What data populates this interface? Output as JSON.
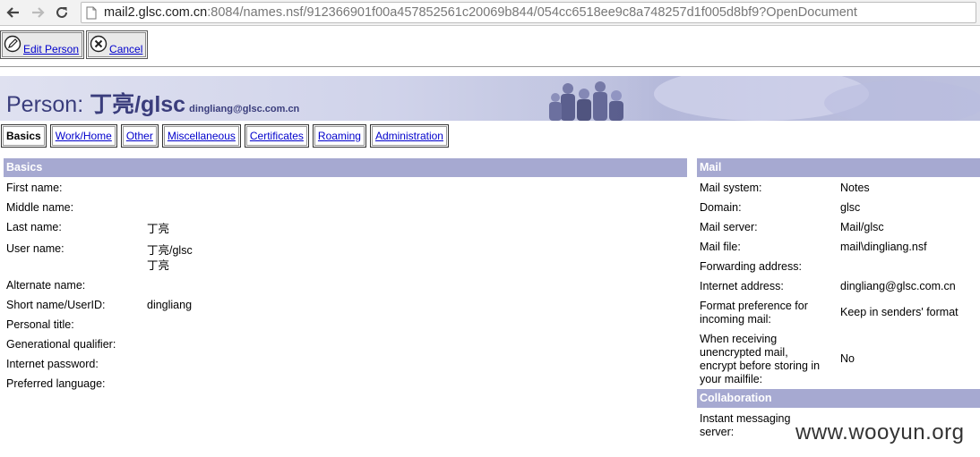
{
  "browser": {
    "url_host": "mail2.glsc.com.cn",
    "url_rest": ":8084/names.nsf/912366901f00a457852561c20069b844/054cc6518ee9c8a748257d1f005d8bf9?OpenDocument"
  },
  "actions": {
    "edit_label": "Edit Person",
    "cancel_label": "Cancel"
  },
  "banner": {
    "prefix": "Person: ",
    "name": "丁亮/glsc",
    "email": "dingliang@glsc.com.cn"
  },
  "tabs": [
    {
      "label": "Basics",
      "active": true
    },
    {
      "label": "Work/Home"
    },
    {
      "label": "Other"
    },
    {
      "label": "Miscellaneous"
    },
    {
      "label": "Certificates"
    },
    {
      "label": "Roaming"
    },
    {
      "label": "Administration"
    }
  ],
  "basics": {
    "header": "Basics",
    "fields": [
      {
        "label": "First name:",
        "value": ""
      },
      {
        "label": "Middle name:",
        "value": ""
      },
      {
        "label": "Last name:",
        "value": "丁亮"
      },
      {
        "label": "User name:",
        "value": "丁亮/glsc",
        "value2": "丁亮"
      },
      {
        "label": "Alternate name:",
        "value": ""
      },
      {
        "label": "Short name/UserID:",
        "value": "dingliang"
      },
      {
        "label": "Personal title:",
        "value": ""
      },
      {
        "label": "Generational qualifier:",
        "value": ""
      },
      {
        "label": "Internet password:",
        "value": ""
      },
      {
        "label": "Preferred language:",
        "value": ""
      }
    ]
  },
  "mail": {
    "header": "Mail",
    "fields": [
      {
        "label": "Mail system:",
        "value": "Notes"
      },
      {
        "label": "Domain:",
        "value": "glsc"
      },
      {
        "label": "Mail server:",
        "value": "Mail/glsc"
      },
      {
        "label": "Mail file:",
        "value": "mail\\dingliang.nsf"
      },
      {
        "label": "Forwarding address:",
        "value": ""
      },
      {
        "label": "Internet address:",
        "value": "dingliang@glsc.com.cn"
      },
      {
        "label": "Format preference for",
        "label2": "incoming mail:",
        "value": "Keep in senders' format"
      },
      {
        "label": "When receiving",
        "label2": "unencrypted mail,",
        "label3": "encrypt before storing in",
        "label4": "your mailfile:",
        "value": "No"
      }
    ]
  },
  "collaboration": {
    "header": "Collaboration",
    "fields": [
      {
        "label": "Instant messaging",
        "label2": "server:",
        "value": ""
      }
    ]
  },
  "watermark": "www.wooyun.org",
  "colors": {
    "section_header_bg": "#a6a9d1",
    "banner_text": "#3a3d7c",
    "link": "#0000cc"
  }
}
